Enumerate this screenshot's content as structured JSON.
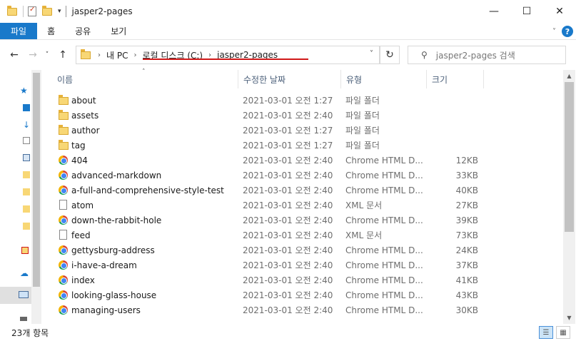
{
  "window": {
    "title": "jasper2-pages",
    "minimize": "—",
    "maximize": "☐",
    "close": "✕"
  },
  "ribbon": {
    "tabs": [
      "파일",
      "홈",
      "공유",
      "보기"
    ],
    "collapse_glyph": "˅",
    "help_glyph": "?"
  },
  "address": {
    "back_glyph": "←",
    "forward_glyph": "→",
    "recent_glyph": "˅",
    "up_glyph": "↑",
    "crumbs": [
      "내 PC",
      "로컬 디스크 (C:)",
      "jasper2-pages"
    ],
    "separator": "›",
    "dropdown_glyph": "˅",
    "refresh_glyph": "↻",
    "search_placeholder": "jasper2-pages 검색",
    "search_icon": "⚲"
  },
  "columns": {
    "name": "이름",
    "date": "수정한 날짜",
    "type": "유형",
    "size": "크기",
    "sort_glyph": "˄"
  },
  "files": [
    {
      "name": "about",
      "date": "2021-03-01 오전 1:27",
      "type": "파일 폴더",
      "size": "",
      "icon": "folder-icon"
    },
    {
      "name": "assets",
      "date": "2021-03-01 오전 2:40",
      "type": "파일 폴더",
      "size": "",
      "icon": "folder-icon"
    },
    {
      "name": "author",
      "date": "2021-03-01 오전 1:27",
      "type": "파일 폴더",
      "size": "",
      "icon": "folder-icon"
    },
    {
      "name": "tag",
      "date": "2021-03-01 오전 1:27",
      "type": "파일 폴더",
      "size": "",
      "icon": "folder-icon"
    },
    {
      "name": "404",
      "date": "2021-03-01 오전 2:40",
      "type": "Chrome HTML D...",
      "size": "12KB",
      "icon": "chrome-icon"
    },
    {
      "name": "advanced-markdown",
      "date": "2021-03-01 오전 2:40",
      "type": "Chrome HTML D...",
      "size": "33KB",
      "icon": "chrome-icon"
    },
    {
      "name": "a-full-and-comprehensive-style-test",
      "date": "2021-03-01 오전 2:40",
      "type": "Chrome HTML D...",
      "size": "40KB",
      "icon": "chrome-icon"
    },
    {
      "name": "atom",
      "date": "2021-03-01 오전 2:40",
      "type": "XML 문서",
      "size": "27KB",
      "icon": "xml-file-icon"
    },
    {
      "name": "down-the-rabbit-hole",
      "date": "2021-03-01 오전 2:40",
      "type": "Chrome HTML D...",
      "size": "39KB",
      "icon": "chrome-icon"
    },
    {
      "name": "feed",
      "date": "2021-03-01 오전 2:40",
      "type": "XML 문서",
      "size": "73KB",
      "icon": "xml-file-icon"
    },
    {
      "name": "gettysburg-address",
      "date": "2021-03-01 오전 2:40",
      "type": "Chrome HTML D...",
      "size": "24KB",
      "icon": "chrome-icon"
    },
    {
      "name": "i-have-a-dream",
      "date": "2021-03-01 오전 2:40",
      "type": "Chrome HTML D...",
      "size": "37KB",
      "icon": "chrome-icon"
    },
    {
      "name": "index",
      "date": "2021-03-01 오전 2:40",
      "type": "Chrome HTML D...",
      "size": "41KB",
      "icon": "chrome-icon"
    },
    {
      "name": "looking-glass-house",
      "date": "2021-03-01 오전 2:40",
      "type": "Chrome HTML D...",
      "size": "43KB",
      "icon": "chrome-icon"
    },
    {
      "name": "managing-users",
      "date": "2021-03-01 오전 2:40",
      "type": "Chrome HTML D...",
      "size": "30KB",
      "icon": "chrome-icon"
    }
  ],
  "status": {
    "item_count": "23개 항목"
  },
  "colors": {
    "accent": "#1979ca",
    "annotation_underline": "#d01818",
    "folder": "#f8d775",
    "header_text": "#4c607a"
  }
}
